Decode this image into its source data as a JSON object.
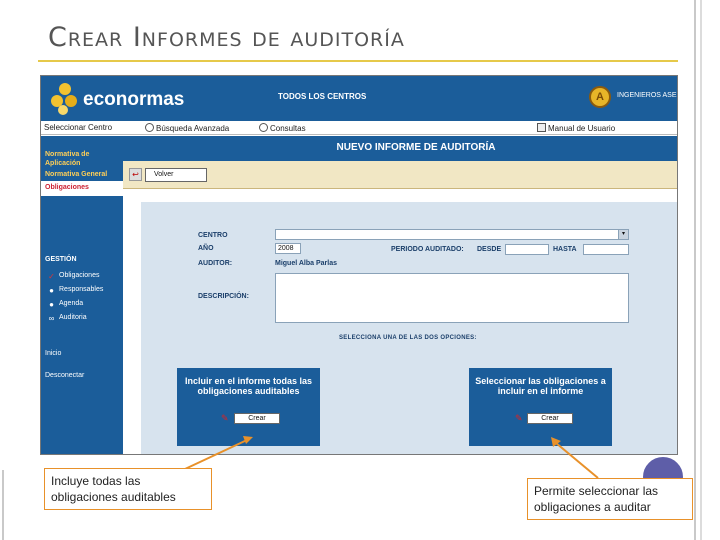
{
  "slide": {
    "title": "Crear Informes de auditoría"
  },
  "app": {
    "logo_text": "econormas",
    "center_title": "TODOS LOS CENTROS",
    "brand_text": "INGENIEROS ASE",
    "brand_mark": "A",
    "nav": [
      {
        "label": "Seleccionar Centro",
        "icon": "none"
      },
      {
        "label": "Búsqueda Avanzada",
        "icon": "gear-icon"
      },
      {
        "label": "Consultas",
        "icon": "gear-icon"
      },
      {
        "label": "Manual de Usuario",
        "icon": "pdf-icon"
      }
    ],
    "sidebar": {
      "normativa_aplicacion": "Normativa de Aplicación",
      "normativa_general": "Normativa General",
      "obligaciones": "Obligaciones",
      "gestion": "GESTIÓN",
      "sub_items": [
        "Obligaciones",
        "Responsables",
        "Agenda",
        "Auditoria"
      ],
      "inicio": "Inicio",
      "desconectar": "Desconectar"
    },
    "main": {
      "header": "NUEVO INFORME DE AUDITORÍA",
      "volver": "Volver",
      "form": {
        "centro_label": "CENTRO",
        "centro_value": "",
        "anio_label": "AÑO",
        "anio_value": "2008",
        "periodo_label": "PERIODO AUDITADO:",
        "desde_label": "DESDE",
        "desde_value": "",
        "hasta_label": "HASTA",
        "hasta_value": "",
        "auditor_label": "AUDITOR:",
        "auditor_value": "Miguel Alba Parlas",
        "descripcion_label": "DESCRIPCIÓN:",
        "seleccion_hint": "SELECCIONA UNA DE LAS DOS OPCIONES:"
      },
      "option1": {
        "text": "Incluir en el informe todas las obligaciones auditables",
        "button": "Crear"
      },
      "option2": {
        "text": "Seleccionar las obligaciones a incluir en el informe",
        "button": "Crear"
      }
    }
  },
  "callouts": {
    "left": "Incluye todas las obligaciones auditables",
    "right": "Permite seleccionar las obligaciones a auditar"
  },
  "colors": {
    "app_blue": "#1b5d9a",
    "accent_gold": "#e6c94a",
    "callout_border": "#e8912a",
    "form_bg": "#d7e3ee"
  }
}
